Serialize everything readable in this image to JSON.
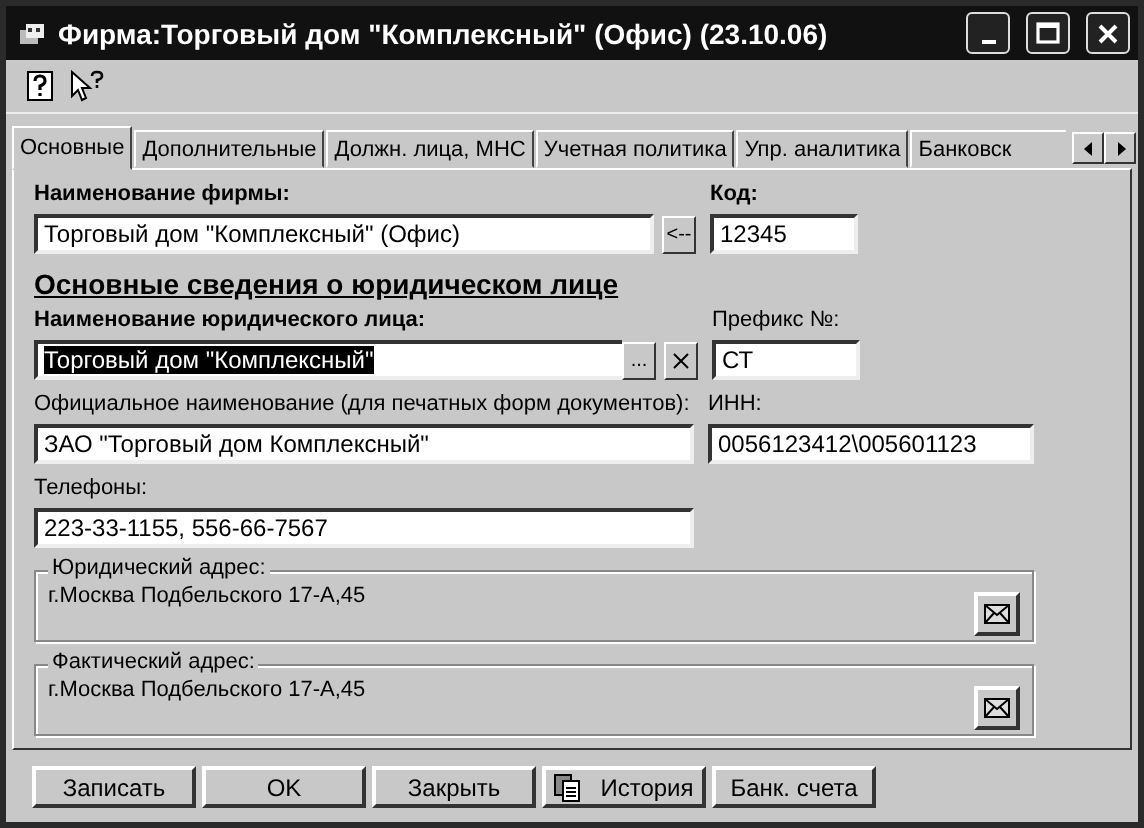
{
  "window": {
    "title": "Фирма:Торговый дом \"Комплексный\" (Офис) (23.10.06)"
  },
  "tabs": [
    {
      "label": "Основные",
      "selected": true
    },
    {
      "label": "Дополнительные",
      "selected": false
    },
    {
      "label": "Должн. лица, МНС",
      "selected": false
    },
    {
      "label": "Учетная политика",
      "selected": false
    },
    {
      "label": "Упр. аналитика",
      "selected": false
    },
    {
      "label": "Банковск",
      "selected": false
    }
  ],
  "form": {
    "firm_name": {
      "label": "Наименование фирмы:",
      "bold": true,
      "value": "Торговый дом \"Комплексный\" (Офис)"
    },
    "copy_button": "<--",
    "code": {
      "label": "Код:",
      "bold": true,
      "value": "12345"
    },
    "section_heading": "Основные сведения о юридическом лице",
    "legal_entity": {
      "label": "Наименование юридического лица:",
      "bold": true,
      "value": "Торговый дом \"Комплексный\"",
      "text_selected": true
    },
    "select_button": "...",
    "prefix": {
      "label": "Префикс №:",
      "bold": false,
      "value": "СТ"
    },
    "official_name": {
      "label": "Официальное наименование (для печатных форм документов):",
      "bold": false,
      "value": "ЗАО \"Торговый дом Комплексный\""
    },
    "inn": {
      "label": "ИНН:",
      "bold": false,
      "value": "0056123412\\005601123"
    },
    "phones": {
      "label": "Телефоны:",
      "bold": false,
      "value": "223-33-1155, 556-66-7567"
    },
    "addresses": [
      {
        "label": "Юридический адрес:",
        "value": "г.Москва Подбельского 17-А,45"
      },
      {
        "label": "Фактический адрес:",
        "value": "г.Москва Подбельского 17-А,45"
      }
    ]
  },
  "buttons": [
    {
      "label": "Записать",
      "kind": "text"
    },
    {
      "label": "OK",
      "kind": "text"
    },
    {
      "label": "Закрыть",
      "kind": "text"
    },
    {
      "label": "История",
      "kind": "icon"
    },
    {
      "label": "Банк. счета",
      "kind": "text"
    }
  ]
}
